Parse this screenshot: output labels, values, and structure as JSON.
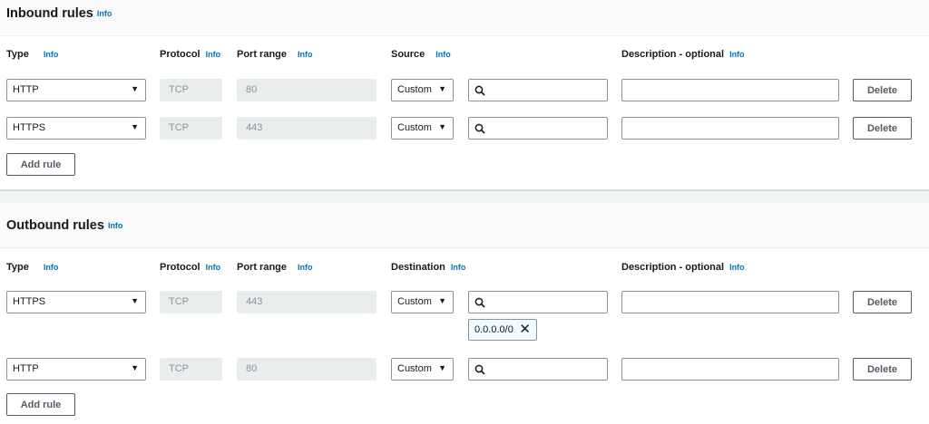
{
  "inbound": {
    "title": "Inbound rules",
    "title_info": "Info",
    "columns": {
      "type": "Type",
      "type_info": "Info",
      "protocol": "Protocol",
      "protocol_info": "Info",
      "port_range": "Port range",
      "port_range_info": "Info",
      "source": "Source",
      "source_info": "Info",
      "description": "Description - optional",
      "description_info": "Info"
    },
    "rules": [
      {
        "type": "HTTP",
        "protocol": "TCP",
        "port_range": "80",
        "source_mode": "Custom",
        "source_value": "",
        "description": "",
        "delete_label": "Delete"
      },
      {
        "type": "HTTPS",
        "protocol": "TCP",
        "port_range": "443",
        "source_mode": "Custom",
        "source_value": "",
        "description": "",
        "delete_label": "Delete"
      }
    ],
    "add_rule_label": "Add rule"
  },
  "outbound": {
    "title": "Outbound rules",
    "title_info": "Info",
    "columns": {
      "type": "Type",
      "type_info": "Info",
      "protocol": "Protocol",
      "protocol_info": "Info",
      "port_range": "Port range",
      "port_range_info": "Info",
      "destination": "Destination",
      "destination_info": "Info",
      "description": "Description - optional",
      "description_info": "Info"
    },
    "rules": [
      {
        "type": "HTTPS",
        "protocol": "TCP",
        "port_range": "443",
        "destination_mode": "Custom",
        "destination_value": "",
        "token": "0.0.0.0/0",
        "description": "",
        "delete_label": "Delete"
      },
      {
        "type": "HTTP",
        "protocol": "TCP",
        "port_range": "80",
        "destination_mode": "Custom",
        "destination_value": "",
        "description": "",
        "delete_label": "Delete"
      }
    ],
    "add_rule_label": "Add rule"
  },
  "icons": {
    "dropdown": "caret-down-icon",
    "search": "search-icon",
    "remove_token": "close-icon"
  },
  "colors": {
    "info_link": "#0073bb",
    "border": "#879596",
    "readonly_bg": "#eaeded",
    "token_bg": "#f1faff"
  }
}
